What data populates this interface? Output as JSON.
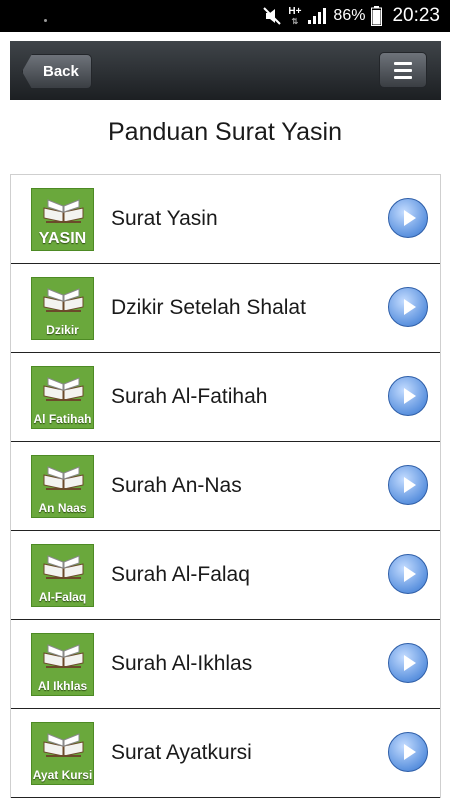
{
  "status_bar": {
    "network_type": "H+",
    "battery_percent": "86%",
    "time": "20:23",
    "icons": [
      "mute-icon",
      "signal-icon",
      "battery-icon"
    ]
  },
  "header": {
    "back_label": "Back",
    "menu_icon": "hamburger-menu-icon"
  },
  "page_title": "Panduan Surat Yasin",
  "colors": {
    "header_dark": "#1c1f22",
    "thumb_green": "#6aa83c",
    "play_blue": "#5d93df"
  },
  "items": [
    {
      "label": "Surat Yasin",
      "thumb_label": "YASIN"
    },
    {
      "label": "Dzikir Setelah Shalat",
      "thumb_label": "Dzikir"
    },
    {
      "label": "Surah Al-Fatihah",
      "thumb_label": "Al Fatihah"
    },
    {
      "label": "Surah An-Nas",
      "thumb_label": "An Naas"
    },
    {
      "label": "Surah Al-Falaq",
      "thumb_label": "Al-Falaq"
    },
    {
      "label": "Surah Al-Ikhlas",
      "thumb_label": "Al Ikhlas"
    },
    {
      "label": "Surat Ayatkursi",
      "thumb_label": "Ayat Kursi"
    }
  ]
}
